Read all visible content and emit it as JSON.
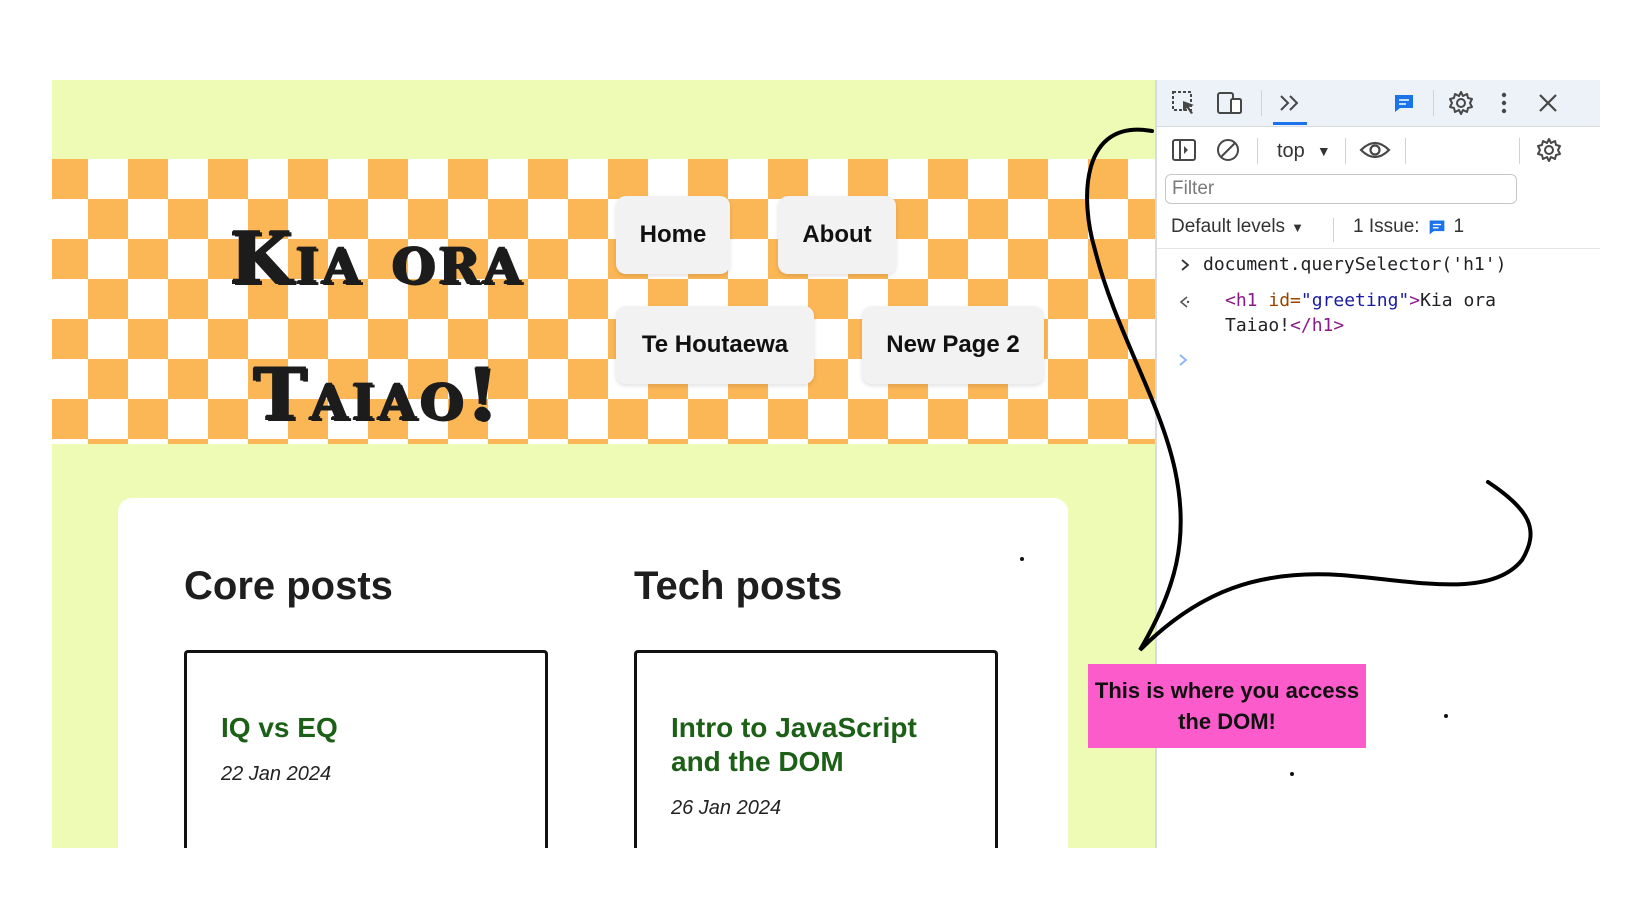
{
  "site": {
    "title": "Kia ora Taiao!",
    "nav": [
      "Home",
      "About",
      "Te Houtaewa",
      "New Page 2"
    ],
    "columns": [
      {
        "heading": "Core posts",
        "post": {
          "title": "IQ vs EQ",
          "date": "22 Jan 2024"
        }
      },
      {
        "heading": "Tech posts",
        "post": {
          "title": "Intro to JavaScript and the DOM",
          "date": "26 Jan 2024"
        }
      }
    ],
    "colors": {
      "page_bg": "#eefbb5",
      "checker": "#fbb655",
      "post_title": "#1c5f17"
    }
  },
  "devtools": {
    "context": "top",
    "filter_placeholder": "Filter",
    "levels": "Default levels",
    "issues_label": "1 Issue:",
    "issues_count": "1",
    "console": {
      "input": "document.querySelector('h1')",
      "output_line1_tag_open": "<h1 ",
      "output_line1_attr": "id=",
      "output_line1_val": "\"greeting\"",
      "output_line1_close": ">",
      "output_line1_text": "Kia ora",
      "output_line2_text": "Taiao!",
      "output_line2_tag": "</h1>"
    },
    "icons": [
      "inspect-icon",
      "device-toggle-icon",
      "more-tabs-icon",
      "issues-icon",
      "settings-icon",
      "kebab-menu-icon",
      "close-icon",
      "sidebar-icon",
      "clear-icon",
      "eye-icon",
      "console-settings-icon"
    ],
    "accent": "#1a73e8"
  },
  "annotation": {
    "text": "This is where you access the DOM!",
    "color": "#fc5ccb"
  }
}
